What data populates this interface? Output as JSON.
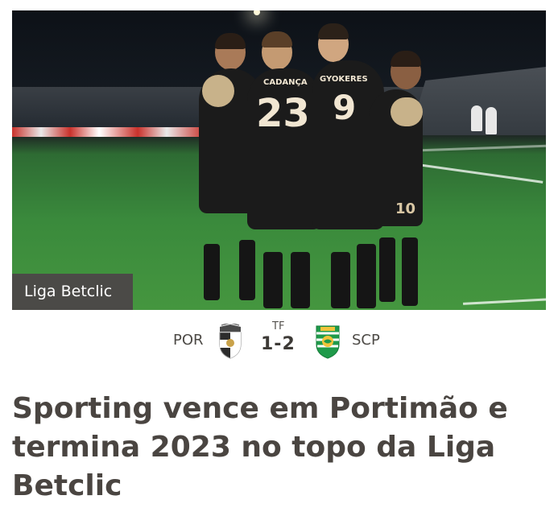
{
  "article": {
    "category_tag": "Liga Betclic",
    "headline": "Sporting vence em Portimão e termina 2023 no topo da Liga Betclic"
  },
  "match": {
    "home": {
      "code": "POR",
      "badge_icon": "portimonense-crest-icon"
    },
    "away": {
      "code": "SCP",
      "badge_icon": "sporting-crest-icon"
    },
    "status": "TF",
    "score": "1-2"
  },
  "photo": {
    "jersey_numbers": [
      "23",
      "9",
      "10"
    ],
    "jersey_names": [
      "CADANÇA",
      "GYOKERES"
    ]
  },
  "colors": {
    "headline_text": "#4a4541",
    "tag_background": "#4b4a47",
    "sporting_green": "#1f9a4a",
    "kit_black": "#1b1b1b",
    "kit_trim": "#d9c7a4"
  }
}
